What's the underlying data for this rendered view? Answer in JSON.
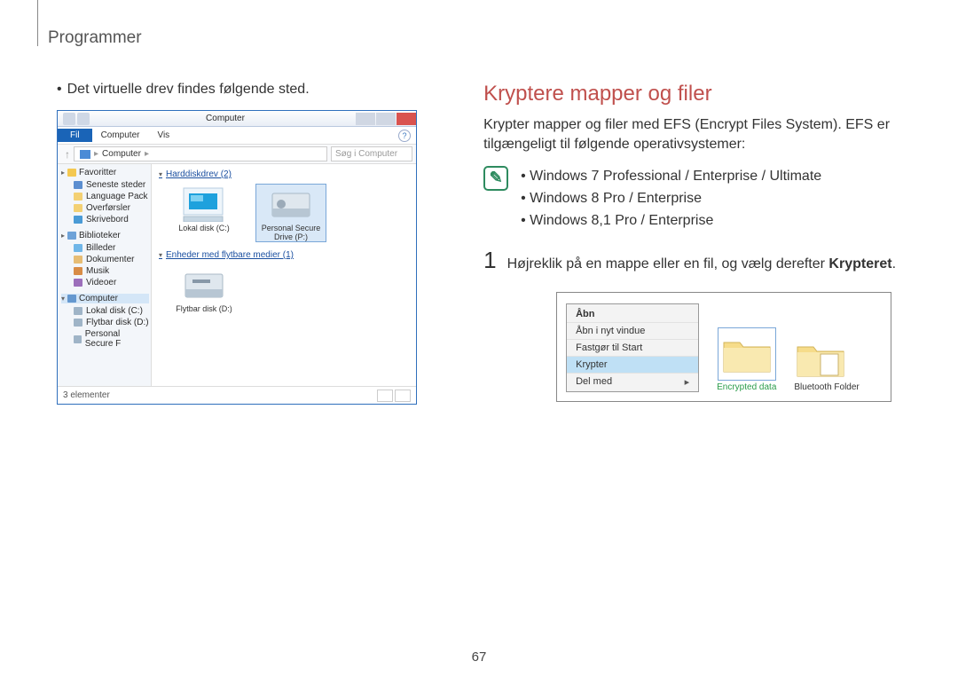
{
  "page": {
    "number": "67",
    "header": "Programmer"
  },
  "left": {
    "bullet": "Det virtuelle drev findes følgende sted.",
    "explorer": {
      "title": "Computer",
      "file_tab": "Fil",
      "menu_computer": "Computer",
      "menu_view": "Vis",
      "breadcrumb": "Computer",
      "search_placeholder": "Søg i Computer",
      "status": "3 elementer",
      "sidebar": {
        "favorites": "Favoritter",
        "fav_items": [
          "Seneste steder",
          "Language Pack",
          "Overførsler",
          "Skrivebord"
        ],
        "libraries": "Biblioteker",
        "lib_items": [
          "Billeder",
          "Dokumenter",
          "Musik",
          "Videoer"
        ],
        "computer": "Computer",
        "comp_items": [
          "Lokal disk (C:)",
          "Flytbar disk (D:)",
          "Personal Secure F"
        ]
      },
      "groups": {
        "hdd": "Harddiskdrev (2)",
        "removable": "Enheder med flytbare medier (1)"
      },
      "drives": {
        "local": "Lokal disk (C:)",
        "secure_line1": "Personal Secure",
        "secure_line2": "Drive (P:)",
        "removable": "Flytbar disk (D:)"
      }
    }
  },
  "right": {
    "title": "Kryptere mapper og filer",
    "intro": "Krypter mapper og filer med EFS (Encrypt Files System). EFS er tilgængeligt til følgende operativsystemer:",
    "info_list": [
      "Windows 7 Professional / Enterprise / Ultimate",
      "Windows 8 Pro / Enterprise",
      "Windows 8,1 Pro / Enterprise"
    ],
    "step1_num": "1",
    "step1_text": "Højreklik på en mappe eller en fil, og vælg derefter ",
    "step1_bold": "Krypteret",
    "step1_end": ".",
    "context_menu": {
      "open": "Åbn",
      "open_new": "Åbn i nyt vindue",
      "pin": "Fastgør til Start",
      "encrypt": "Krypter",
      "share": "Del med"
    },
    "folders": {
      "encrypted": "Encrypted data",
      "bluetooth": "Bluetooth Folder"
    }
  }
}
